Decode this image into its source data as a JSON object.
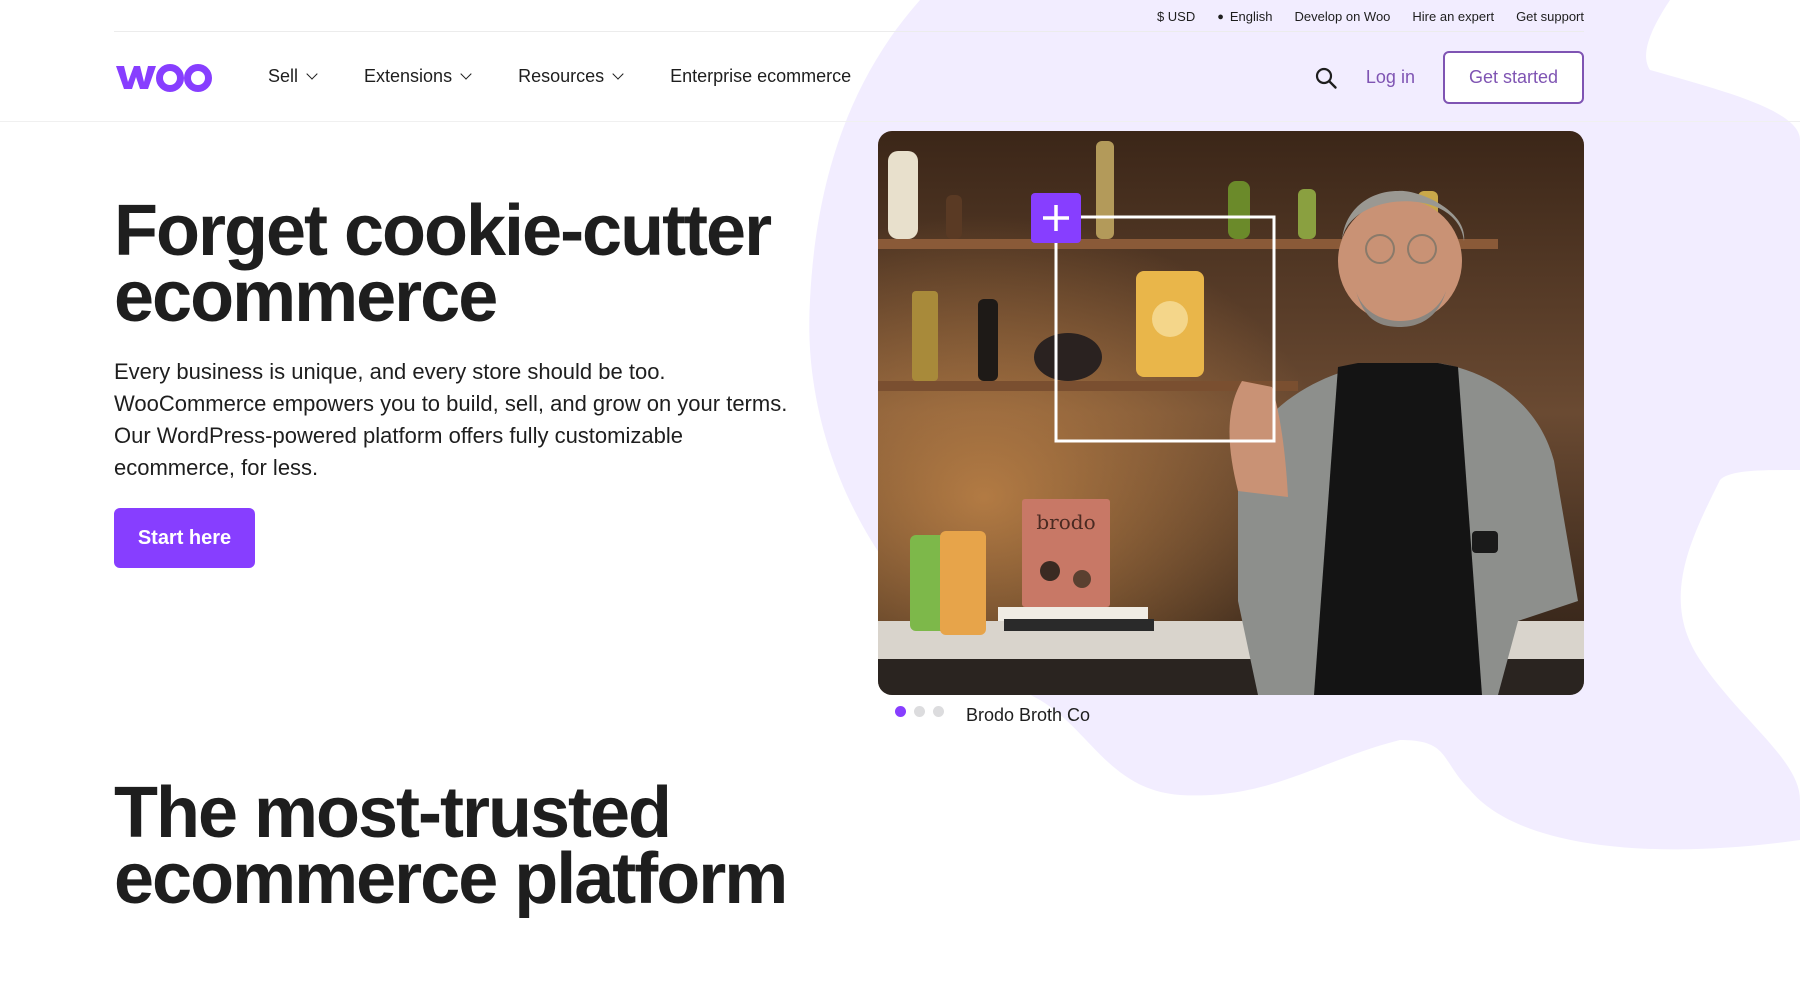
{
  "topbar": {
    "currency": "$ USD",
    "language": "English",
    "develop": "Develop on Woo",
    "hire": "Hire an expert",
    "support": "Get support"
  },
  "nav": {
    "logo": "woo",
    "items": [
      "Sell",
      "Extensions",
      "Resources",
      "Enterprise ecommerce"
    ],
    "login": "Log in",
    "get_started": "Get started"
  },
  "hero": {
    "title": "Forget cookie-cutter ecommerce",
    "body": "Every business is unique, and every store should be too. WooCommerce empowers you to build, sell, and grow on your terms. Our WordPress-powered platform offers fully customizable ecommerce, for less.",
    "cta": "Start here",
    "caption": "Brodo Broth Co",
    "carousel_active": 1,
    "carousel_count": 3,
    "book_title": "brodo"
  },
  "section": {
    "title": "The most-trusted ecommerce platform"
  },
  "colors": {
    "brand_purple": "#873eff",
    "link_purple": "#7f54b3",
    "blob_lavender": "#f2edff",
    "text": "#1e1e1e"
  },
  "icons": {
    "search": "search-icon",
    "globe": "globe-icon",
    "chevron": "chevron-down-icon",
    "plus": "plus-icon"
  }
}
